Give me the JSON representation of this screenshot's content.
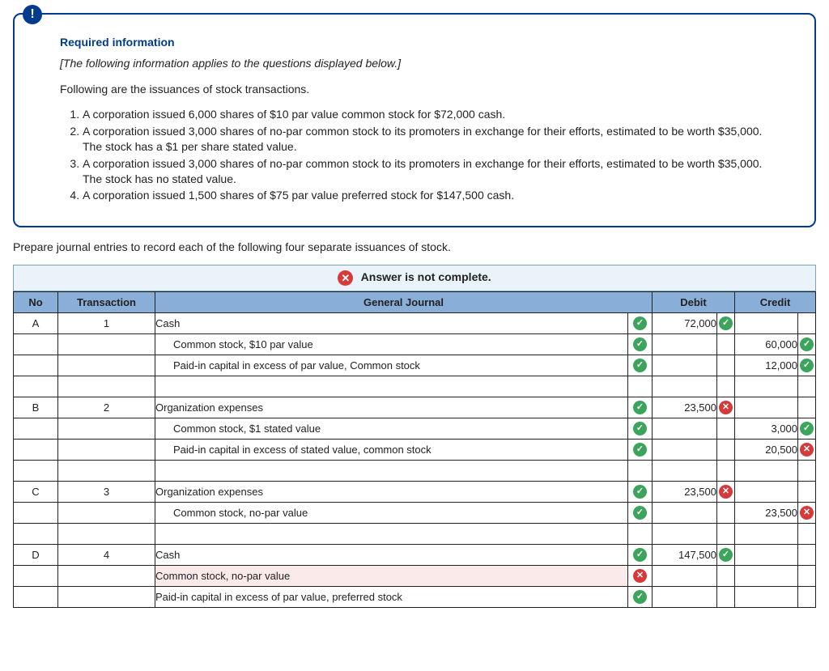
{
  "info": {
    "title": "Required information",
    "note": "[The following information applies to the questions displayed below.]",
    "intro": "Following are the issuances of stock transactions.",
    "items": [
      "A corporation issued 6,000 shares of $10 par value common stock for $72,000 cash.",
      "A corporation issued 3,000 shares of no-par common stock to its promoters in exchange for their efforts, estimated to be worth $35,000. The stock has a $1 per share stated value.",
      "A corporation issued 3,000 shares of no-par common stock to its promoters in exchange for their efforts, estimated to be worth $35,000. The stock has no stated value.",
      "A corporation issued 1,500 shares of $75 par value preferred stock for $147,500 cash."
    ]
  },
  "prompt": "Prepare journal entries to record each of the following four separate issuances of stock.",
  "status": "Answer is not complete.",
  "headers": {
    "no": "No",
    "txn": "Transaction",
    "journal": "General Journal",
    "debit": "Debit",
    "credit": "Credit"
  },
  "rows": [
    {
      "no": "A",
      "txn": "1",
      "acct": "Cash",
      "indent": false,
      "acct_mark": "ok",
      "debit": "72,000",
      "debit_mark": "ok",
      "credit": "",
      "credit_mark": ""
    },
    {
      "no": "",
      "txn": "",
      "acct": "Common stock, $10 par value",
      "indent": true,
      "acct_mark": "ok",
      "debit": "",
      "debit_mark": "",
      "credit": "60,000",
      "credit_mark": "ok"
    },
    {
      "no": "",
      "txn": "",
      "acct": "Paid-in capital in excess of par value, Common stock",
      "indent": true,
      "acct_mark": "ok",
      "debit": "",
      "debit_mark": "",
      "credit": "12,000",
      "credit_mark": "ok"
    },
    {
      "blank": true
    },
    {
      "no": "B",
      "txn": "2",
      "acct": "Organization expenses",
      "indent": false,
      "acct_mark": "ok",
      "debit": "23,500",
      "debit_mark": "bad",
      "credit": "",
      "credit_mark": ""
    },
    {
      "no": "",
      "txn": "",
      "acct": "Common stock, $1 stated value",
      "indent": true,
      "acct_mark": "ok",
      "debit": "",
      "debit_mark": "",
      "credit": "3,000",
      "credit_mark": "ok"
    },
    {
      "no": "",
      "txn": "",
      "acct": "Paid-in capital in excess of stated value, common stock",
      "indent": true,
      "acct_mark": "ok",
      "debit": "",
      "debit_mark": "",
      "credit": "20,500",
      "credit_mark": "bad"
    },
    {
      "blank": true
    },
    {
      "no": "C",
      "txn": "3",
      "acct": "Organization expenses",
      "indent": false,
      "acct_mark": "ok",
      "debit": "23,500",
      "debit_mark": "bad",
      "credit": "",
      "credit_mark": ""
    },
    {
      "no": "",
      "txn": "",
      "acct": "Common stock, no-par value",
      "indent": true,
      "acct_mark": "ok",
      "debit": "",
      "debit_mark": "",
      "credit": "23,500",
      "credit_mark": "bad"
    },
    {
      "blank": true
    },
    {
      "no": "D",
      "txn": "4",
      "acct": "Cash",
      "indent": false,
      "acct_mark": "ok",
      "debit": "147,500",
      "debit_mark": "ok",
      "credit": "",
      "credit_mark": ""
    },
    {
      "no": "",
      "txn": "",
      "acct": "Common stock, no-par value",
      "indent": false,
      "acct_mark": "bad",
      "debit": "",
      "debit_mark": "",
      "credit": "",
      "credit_mark": "",
      "err": true
    },
    {
      "no": "",
      "txn": "",
      "acct": "Paid-in capital in excess of par value, preferred stock",
      "indent": false,
      "acct_mark": "ok",
      "debit": "",
      "debit_mark": "",
      "credit": "",
      "credit_mark": ""
    }
  ]
}
